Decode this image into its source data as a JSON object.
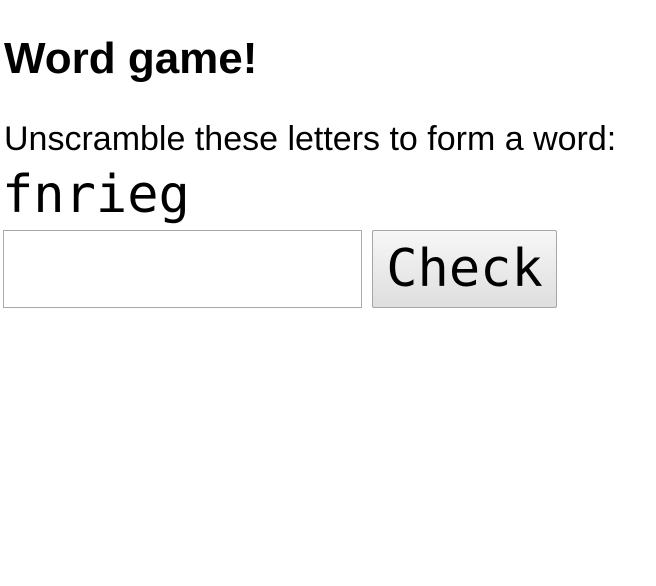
{
  "game": {
    "title": "Word game!",
    "instructions": "Unscramble these letters to form a word:",
    "scrambled_letters": "fnrieg"
  },
  "answer": {
    "value": "",
    "placeholder": ""
  },
  "check_button": {
    "label": "Check"
  }
}
